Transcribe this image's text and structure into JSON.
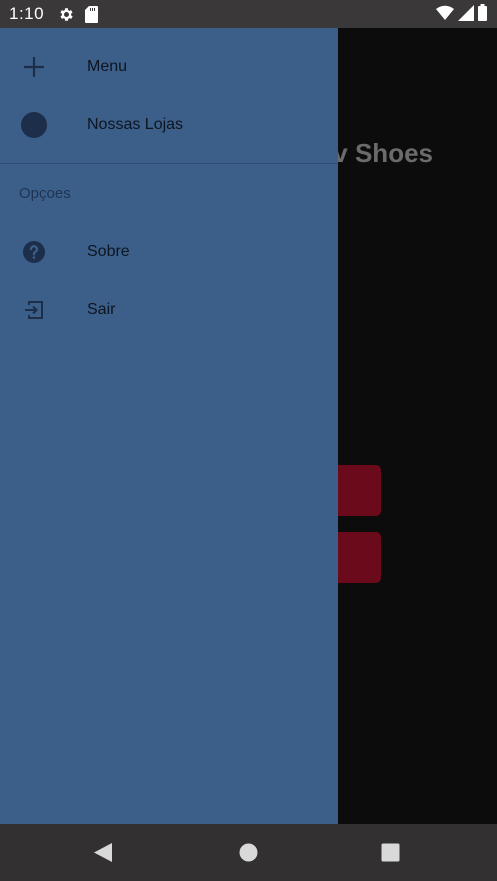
{
  "status_bar": {
    "time": "1:10",
    "icons": [
      "gear-icon",
      "sd-card-icon",
      "wifi-icon",
      "signal-icon",
      "battery-icon"
    ]
  },
  "background_app": {
    "title_partial": "v Shoes",
    "button_color": "#6b0a1a"
  },
  "drawer": {
    "background_color": "#3c5f8a",
    "items": [
      {
        "label": "Menu",
        "icon": "plus-icon"
      },
      {
        "label": "Nossas Lojas",
        "icon": "circle-icon"
      }
    ],
    "section_header": "Opçoes",
    "section_items": [
      {
        "label": "Sobre",
        "icon": "help-circle-icon"
      },
      {
        "label": "Sair",
        "icon": "exit-icon"
      }
    ]
  },
  "nav_bar": {
    "buttons": [
      "back-icon",
      "home-icon",
      "recent-apps-icon"
    ]
  }
}
